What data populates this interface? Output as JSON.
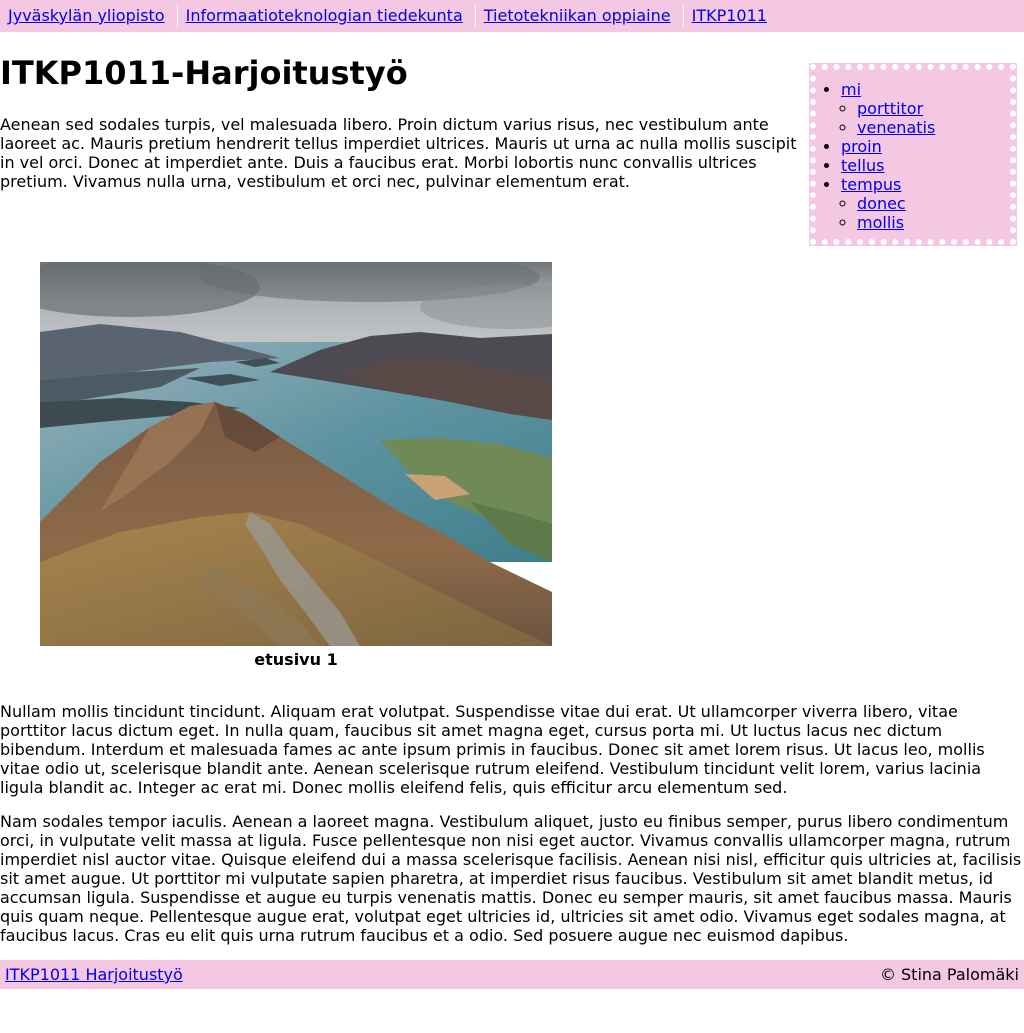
{
  "breadcrumb": [
    {
      "label": "Jyväskylän yliopisto"
    },
    {
      "label": "Informaatioteknologian tiedekunta"
    },
    {
      "label": "Tietotekniikan oppiaine"
    },
    {
      "label": "ITKP1011"
    }
  ],
  "page_title": "ITKP1011-Harjoitustyö",
  "intro": "Aenean sed sodales turpis, vel malesuada libero. Proin dictum varius risus, nec vestibulum ante laoreet ac. Mauris pretium hendrerit tellus imperdiet ultrices. Mauris ut urna ac nulla mollis suscipit in vel orci. Donec at imperdiet ante. Duis a faucibus erat. Morbi lobortis nunc convallis ultrices pretium. Vivamus nulla urna, vestibulum et orci nec, pulvinar elementum erat.",
  "sidenav": {
    "items": [
      {
        "label": "mi",
        "children": [
          {
            "label": "porttitor"
          },
          {
            "label": "venenatis"
          }
        ]
      },
      {
        "label": "proin"
      },
      {
        "label": "tellus"
      },
      {
        "label": "tempus",
        "children": [
          {
            "label": "donec"
          },
          {
            "label": "mollis"
          }
        ]
      }
    ]
  },
  "figure": {
    "caption": "etusivu 1"
  },
  "paragraphs": [
    "Nullam mollis tincidunt tincidunt. Aliquam erat volutpat. Suspendisse vitae dui erat. Ut ullamcorper viverra libero, vitae porttitor lacus dictum eget. In nulla quam, faucibus sit amet magna eget, cursus porta mi. Ut luctus lacus nec dictum bibendum. Interdum et malesuada fames ac ante ipsum primis in faucibus. Donec sit amet lorem risus. Ut lacus leo, mollis vitae odio ut, scelerisque blandit ante. Aenean scelerisque rutrum eleifend. Vestibulum tincidunt velit lorem, varius lacinia ligula blandit ac. Integer ac erat mi. Donec mollis eleifend felis, quis efficitur arcu elementum sed.",
    "Nam sodales tempor iaculis. Aenean a laoreet magna. Vestibulum aliquet, justo eu finibus semper, purus libero condimentum orci, in vulputate velit massa at ligula. Fusce pellentesque non nisi eget auctor. Vivamus convallis ullamcorper magna, rutrum imperdiet nisl auctor vitae. Quisque eleifend dui a massa scelerisque facilisis. Aenean nisi nisl, efficitur quis ultricies at, facilisis sit amet augue. Ut porttitor mi vulputate sapien pharetra, at imperdiet risus faucibus. Vestibulum sit amet blandit metus, id accumsan ligula. Suspendisse et augue eu turpis venenatis mattis. Donec eu semper mauris, sit amet faucibus massa. Mauris quis quam neque. Pellentesque augue erat, volutpat eget ultricies id, ultricies sit amet odio. Vivamus eget sodales magna, at faucibus lacus. Cras eu elit quis urna rutrum faucibus et a odio. Sed posuere augue nec euismod dapibus."
  ],
  "footer": {
    "link": "ITKP1011 Harjoitustyö",
    "copyright": "© Stina Palomäki"
  },
  "colors": {
    "accent_pink": "#f4c8e2",
    "link": "#0000ee"
  }
}
